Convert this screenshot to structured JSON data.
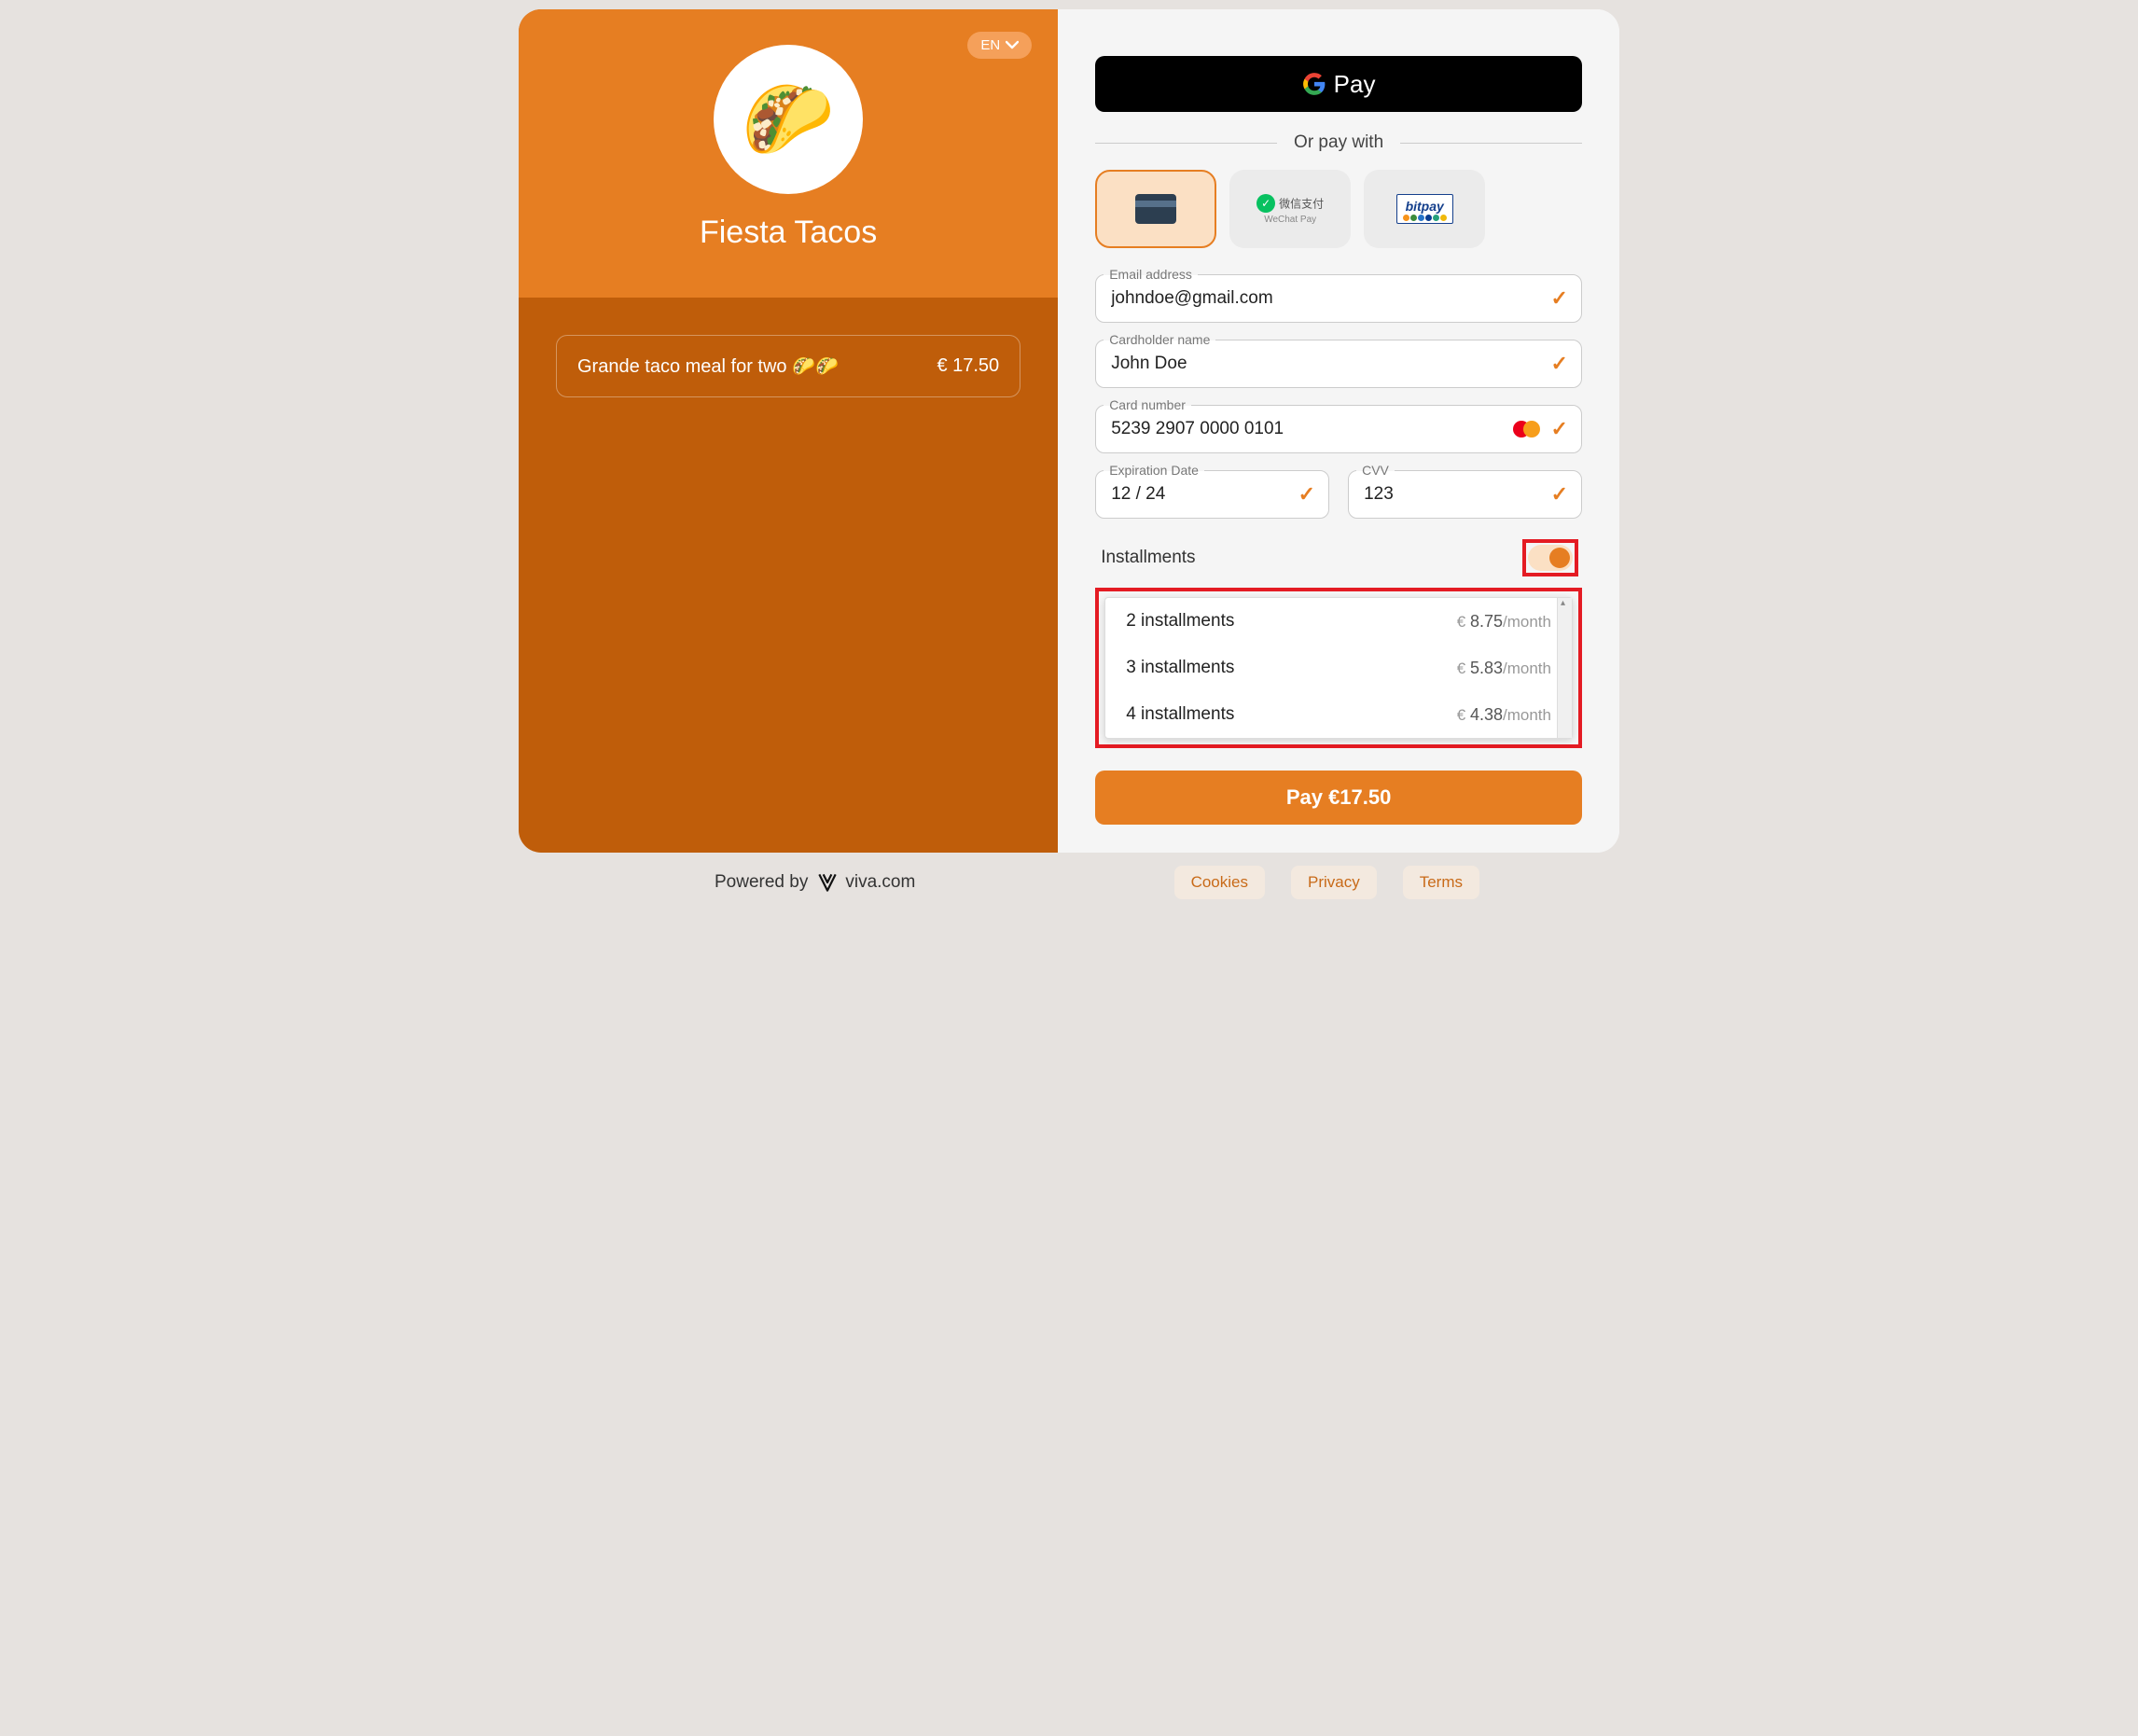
{
  "language": {
    "code": "EN"
  },
  "merchant": {
    "name": "Fiesta Tacos",
    "logo_emoji": "🌮"
  },
  "order": {
    "item_label": "Grande taco meal for two 🌮🌮",
    "price": "€ 17.50"
  },
  "gpay": {
    "label": "Pay"
  },
  "divider": "Or pay with",
  "methods": {
    "wechat_cn": "微信支付",
    "wechat_en": "WeChat Pay",
    "bitpay": "bitpay"
  },
  "fields": {
    "email_label": "Email address",
    "email_value": "johndoe@gmail.com",
    "cardholder_label": "Cardholder name",
    "cardholder_value": "John Doe",
    "cardnumber_label": "Card number",
    "cardnumber_value": "5239 2907 0000 0101",
    "exp_label": "Expiration Date",
    "exp_value": "12 / 24",
    "cvv_label": "CVV",
    "cvv_value": "123"
  },
  "installments": {
    "label": "Installments",
    "options": [
      {
        "label": "2 installments",
        "currency": "€",
        "amount": "8.75",
        "suffix": "/month"
      },
      {
        "label": "3 installments",
        "currency": "€",
        "amount": "5.83",
        "suffix": "/month"
      },
      {
        "label": "4 installments",
        "currency": "€",
        "amount": "4.38",
        "suffix": "/month"
      }
    ]
  },
  "pay_button": "Pay €17.50",
  "footer": {
    "powered": "Powered by",
    "brand": "viva.com",
    "links": {
      "cookies": "Cookies",
      "privacy": "Privacy",
      "terms": "Terms"
    }
  }
}
